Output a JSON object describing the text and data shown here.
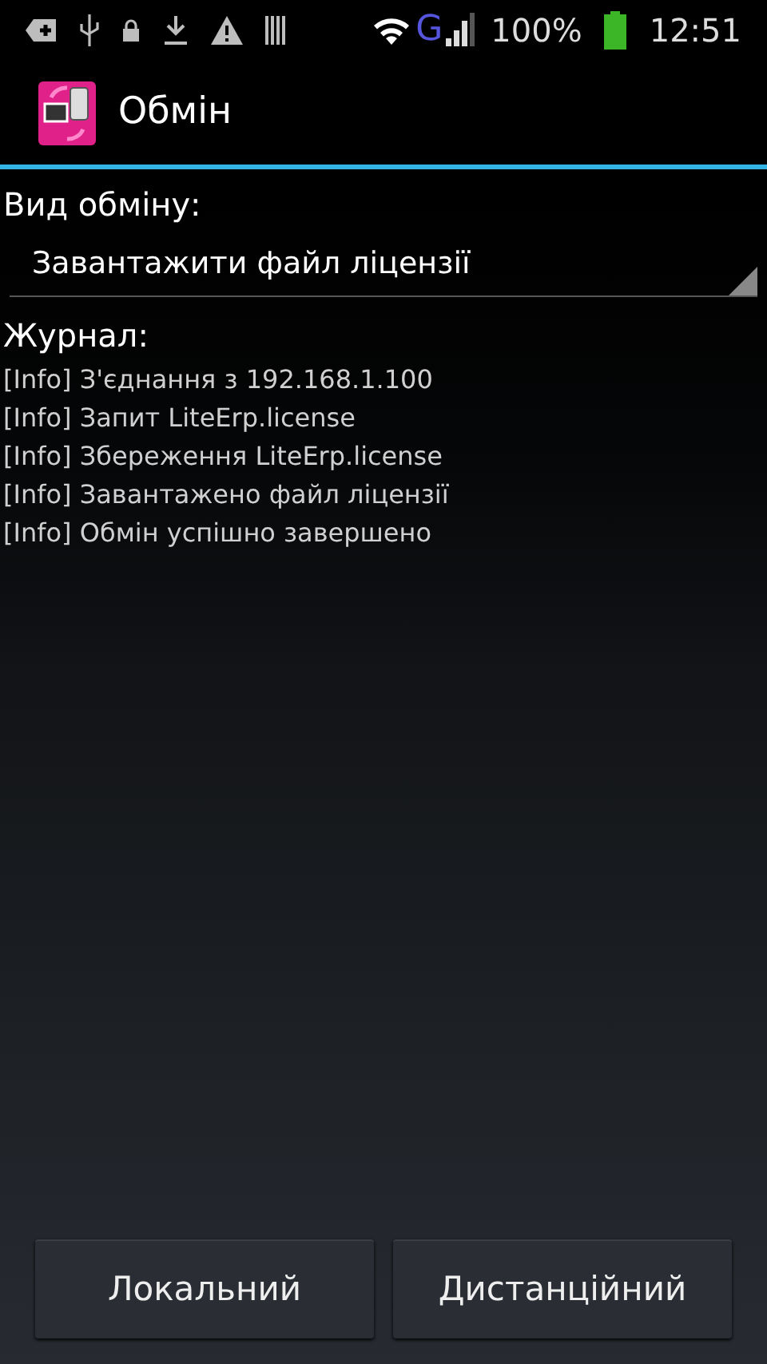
{
  "status_bar": {
    "network": "G",
    "battery": "100%",
    "time": "12:51"
  },
  "action_bar": {
    "title": "Обмін"
  },
  "exchange_type": {
    "label": "Вид обміну:",
    "value": "Завантажити файл ліцензії"
  },
  "log": {
    "label": "Журнал:",
    "lines": [
      "[Info] З'єднання з 192.168.1.100",
      "[Info] Запит LiteErp.license",
      "[Info] Збереження LiteErp.license",
      "[Info] Завантажено файл ліцензії",
      "[Info] Обмін успішно завершено"
    ]
  },
  "buttons": [
    "Локальний",
    "Дистанційний"
  ]
}
